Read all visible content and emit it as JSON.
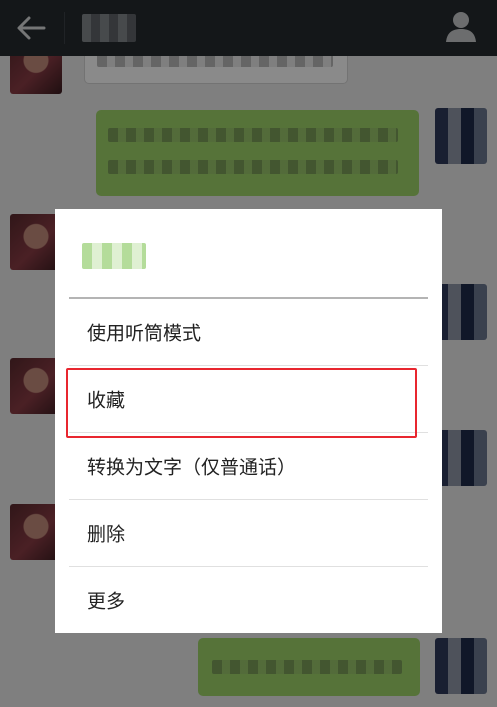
{
  "header": {
    "title": "",
    "back_icon": "arrow-left-icon",
    "profile_icon": "person-icon"
  },
  "dialog": {
    "title": "",
    "items": [
      {
        "label": "使用听筒模式"
      },
      {
        "label": "收藏"
      },
      {
        "label": "转换为文字（仅普通话）"
      },
      {
        "label": "删除"
      },
      {
        "label": "更多"
      }
    ],
    "highlighted_item": "收藏"
  },
  "colors": {
    "topbar": "#262b2f",
    "outgoing_bubble": "#9fd46a",
    "incoming_bubble": "#ffffff",
    "chat_background": "#ebebeb",
    "highlight_border": "#e8262f"
  }
}
